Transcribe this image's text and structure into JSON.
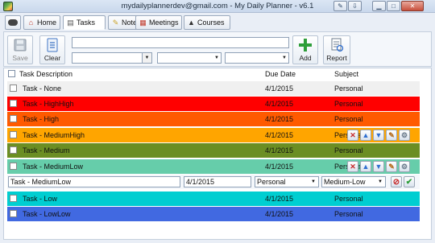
{
  "window": {
    "title": "mydailyplannerdev@gmail.com - My Daily Planner - v6.1",
    "buttons": [
      "pin",
      "restore-alt",
      "minimize",
      "maximize",
      "close"
    ]
  },
  "tabs": [
    {
      "label": "Home",
      "icon": "home-icon"
    },
    {
      "label": "Tasks",
      "icon": "tasks-icon"
    },
    {
      "label": "Notes",
      "icon": "notes-icon"
    },
    {
      "label": "Meetings",
      "icon": "calendar-icon"
    },
    {
      "label": "Courses",
      "icon": "graduation-cap-icon"
    }
  ],
  "toolbar": {
    "save_label": "Save",
    "clear_label": "Clear",
    "add_label": "Add",
    "report_label": "Report",
    "task_input_value": "",
    "date_value": "",
    "subject_value": "",
    "priority_value": ""
  },
  "list": {
    "headers": {
      "description": "Task Description",
      "due": "Due Date",
      "subject": "Subject"
    },
    "rows": [
      {
        "description": "Task - None",
        "due": "4/1/2015",
        "subject": "Personal",
        "color": "#f0f0f0",
        "text_color": "#111111"
      },
      {
        "description": "Task - HighHigh",
        "due": "4/1/2015",
        "subject": "Personal",
        "color": "#ff0000",
        "text_color": "#111111"
      },
      {
        "description": "Task - High",
        "due": "4/1/2015",
        "subject": "Personal",
        "color": "#ff5a00",
        "text_color": "#111111"
      },
      {
        "description": "Task - MediumHigh",
        "due": "4/1/2015",
        "subject": "Personal",
        "color": "#ffa500",
        "text_color": "#111111"
      },
      {
        "description": "Task - Medium",
        "due": "4/1/2015",
        "subject": "Personal",
        "color": "#6b8e23",
        "text_color": "#111111"
      },
      {
        "description": "Task - MediumLow",
        "due": "4/1/2015",
        "subject": "Personal",
        "color": "#66cdaa",
        "text_color": "#111111"
      },
      {
        "description": "Task - Low",
        "due": "4/1/2015",
        "subject": "Personal",
        "color": "#00ced1",
        "text_color": "#111111"
      },
      {
        "description": "Task - LowLow",
        "due": "4/1/2015",
        "subject": "Personal",
        "color": "#4169e1",
        "text_color": "#111111"
      }
    ],
    "edit": {
      "description_value": "Task - MediumLow",
      "due_value": "4/1/2015",
      "subject_value": "Personal",
      "priority_value": "Medium-Low"
    }
  }
}
